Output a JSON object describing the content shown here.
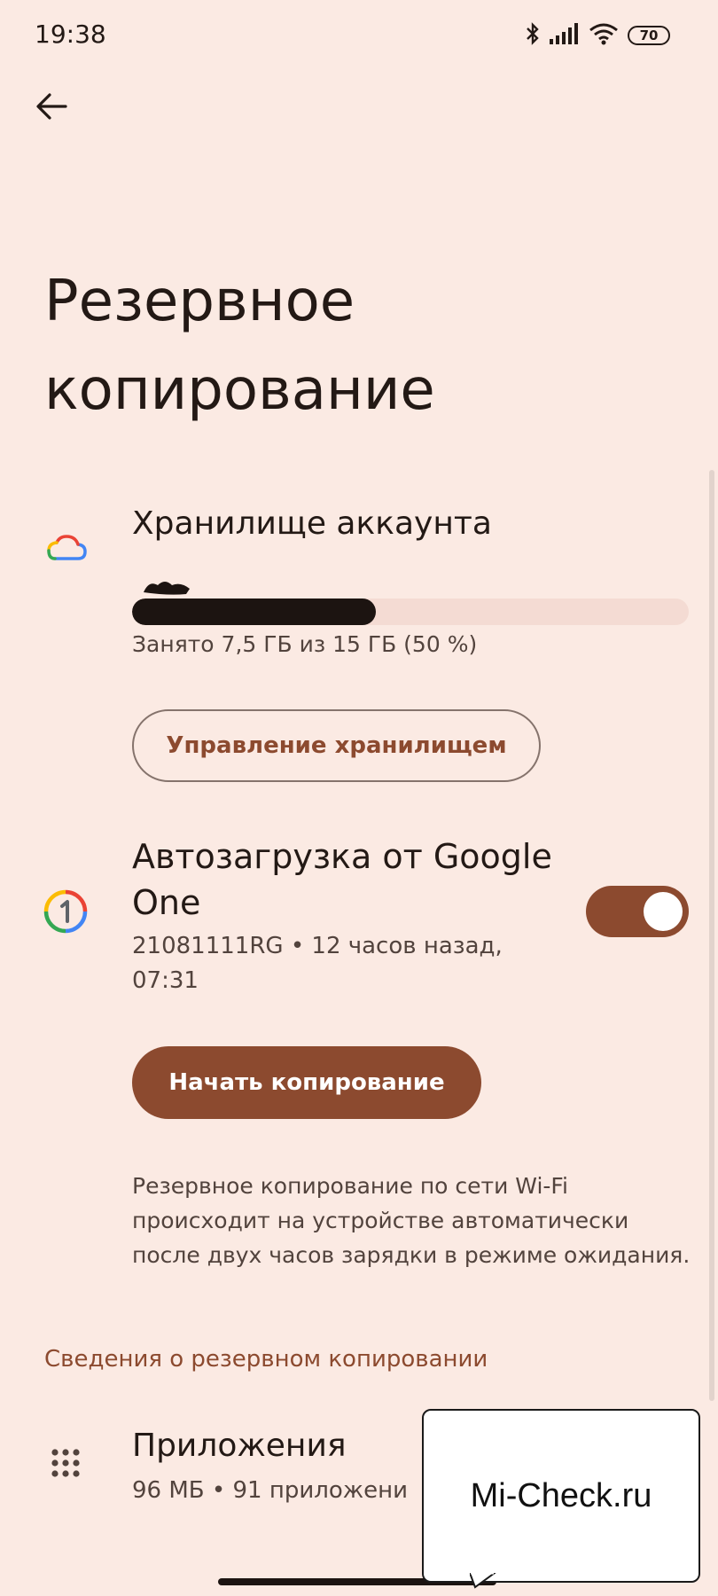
{
  "status_bar": {
    "time": "19:38",
    "battery": "70",
    "icons": [
      "bluetooth-icon",
      "signal-icon",
      "wifi-icon",
      "battery-icon"
    ]
  },
  "header": {
    "back_icon": "arrow-back-icon",
    "title": "Резервное копирование"
  },
  "storage": {
    "icon": "google-cloud-icon",
    "title": "Хранилище аккаунта",
    "used_fraction": 0.5,
    "subtitle": "Занято 7,5 ГБ из 15 ГБ (50 %)",
    "manage_button": "Управление хранилищем"
  },
  "google_one": {
    "icon": "google-one-icon",
    "title": "Автозагрузка от Google One",
    "subtitle": "21081111RG • 12 часов назад, 07:31",
    "toggle_on": true,
    "start_button": "Начать копирование"
  },
  "info": {
    "text": "Резервное копирование по сети Wi-Fi происходит на устройстве автоматически после двух часов зарядки в режиме ожидания."
  },
  "backup_details": {
    "section_title": "Сведения о резервном копировании",
    "apps": {
      "icon": "apps-grid-icon",
      "title": "Приложения",
      "subtitle": "96 МБ • 91 приложени"
    }
  },
  "watermark": {
    "text": "Mi-Check.ru"
  },
  "colors": {
    "background": "#fbeae3",
    "accent": "#8c4a2f",
    "text_primary": "#231915",
    "text_secondary": "#52433d"
  }
}
